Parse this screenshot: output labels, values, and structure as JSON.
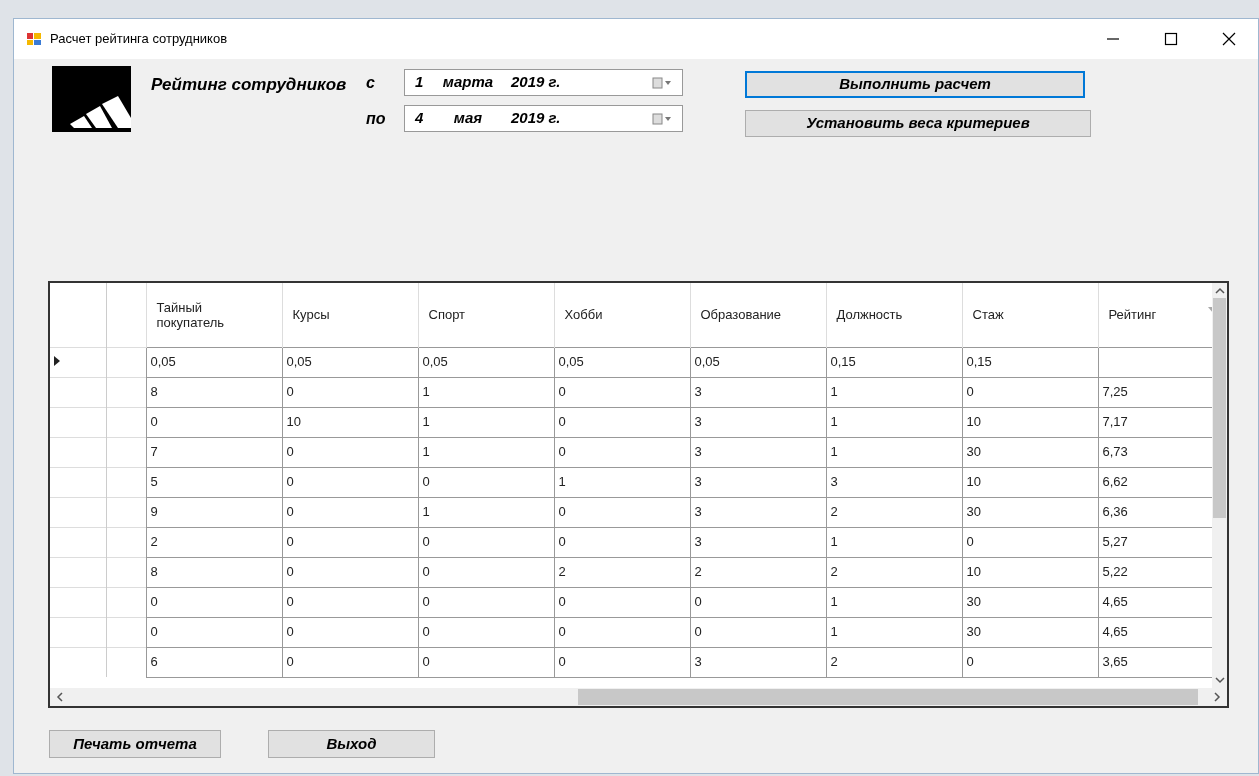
{
  "window": {
    "title": "Расчет рейтинга сотрудников"
  },
  "header": {
    "title": "Рейтинг сотрудников"
  },
  "dates": [
    {
      "label": "с",
      "day": "1",
      "month": "марта",
      "year": "2019 г."
    },
    {
      "label": "по",
      "day": "4",
      "month": "мая",
      "year": "2019 г."
    }
  ],
  "actions": [
    {
      "label": "Выполнить расчет",
      "focused": true
    },
    {
      "label": "Установить веса  критериев",
      "focused": false
    }
  ],
  "table": {
    "columns": [
      "",
      "Тайный покупатель",
      "Курсы",
      "Спорт",
      "Хобби",
      "Образование",
      "Должность",
      "Стаж",
      "Рейтинг"
    ],
    "rows": [
      {
        "current": true,
        "cells": [
          "",
          "0,05",
          "0,05",
          "0,05",
          "0,05",
          "0,05",
          "0,15",
          "0,15",
          ""
        ]
      },
      {
        "current": false,
        "cells": [
          "",
          "8",
          "0",
          "1",
          "0",
          "3",
          "1",
          "0",
          "7,25"
        ]
      },
      {
        "current": false,
        "cells": [
          "",
          "0",
          "10",
          "1",
          "0",
          "3",
          "1",
          "10",
          "7,17"
        ]
      },
      {
        "current": false,
        "cells": [
          "",
          "7",
          "0",
          "1",
          "0",
          "3",
          "1",
          "30",
          "6,73"
        ]
      },
      {
        "current": false,
        "cells": [
          "",
          "5",
          "0",
          "0",
          "1",
          "3",
          "3",
          "10",
          "6,62"
        ]
      },
      {
        "current": false,
        "cells": [
          "",
          "9",
          "0",
          "1",
          "0",
          "3",
          "2",
          "30",
          "6,36"
        ]
      },
      {
        "current": false,
        "cells": [
          "",
          "2",
          "0",
          "0",
          "0",
          "3",
          "1",
          "0",
          "5,27"
        ]
      },
      {
        "current": false,
        "cells": [
          "",
          "8",
          "0",
          "0",
          "2",
          "2",
          "2",
          "10",
          "5,22"
        ]
      },
      {
        "current": false,
        "cells": [
          "",
          "0",
          "0",
          "0",
          "0",
          "0",
          "1",
          "30",
          "4,65"
        ]
      },
      {
        "current": false,
        "cells": [
          "",
          "0",
          "0",
          "0",
          "0",
          "0",
          "1",
          "30",
          "4,65"
        ]
      },
      {
        "current": false,
        "cells": [
          "",
          "6",
          "0",
          "0",
          "0",
          "3",
          "2",
          "0",
          "3,65"
        ]
      }
    ]
  },
  "footer_buttons": [
    "Печать отчета",
    "Выход"
  ]
}
